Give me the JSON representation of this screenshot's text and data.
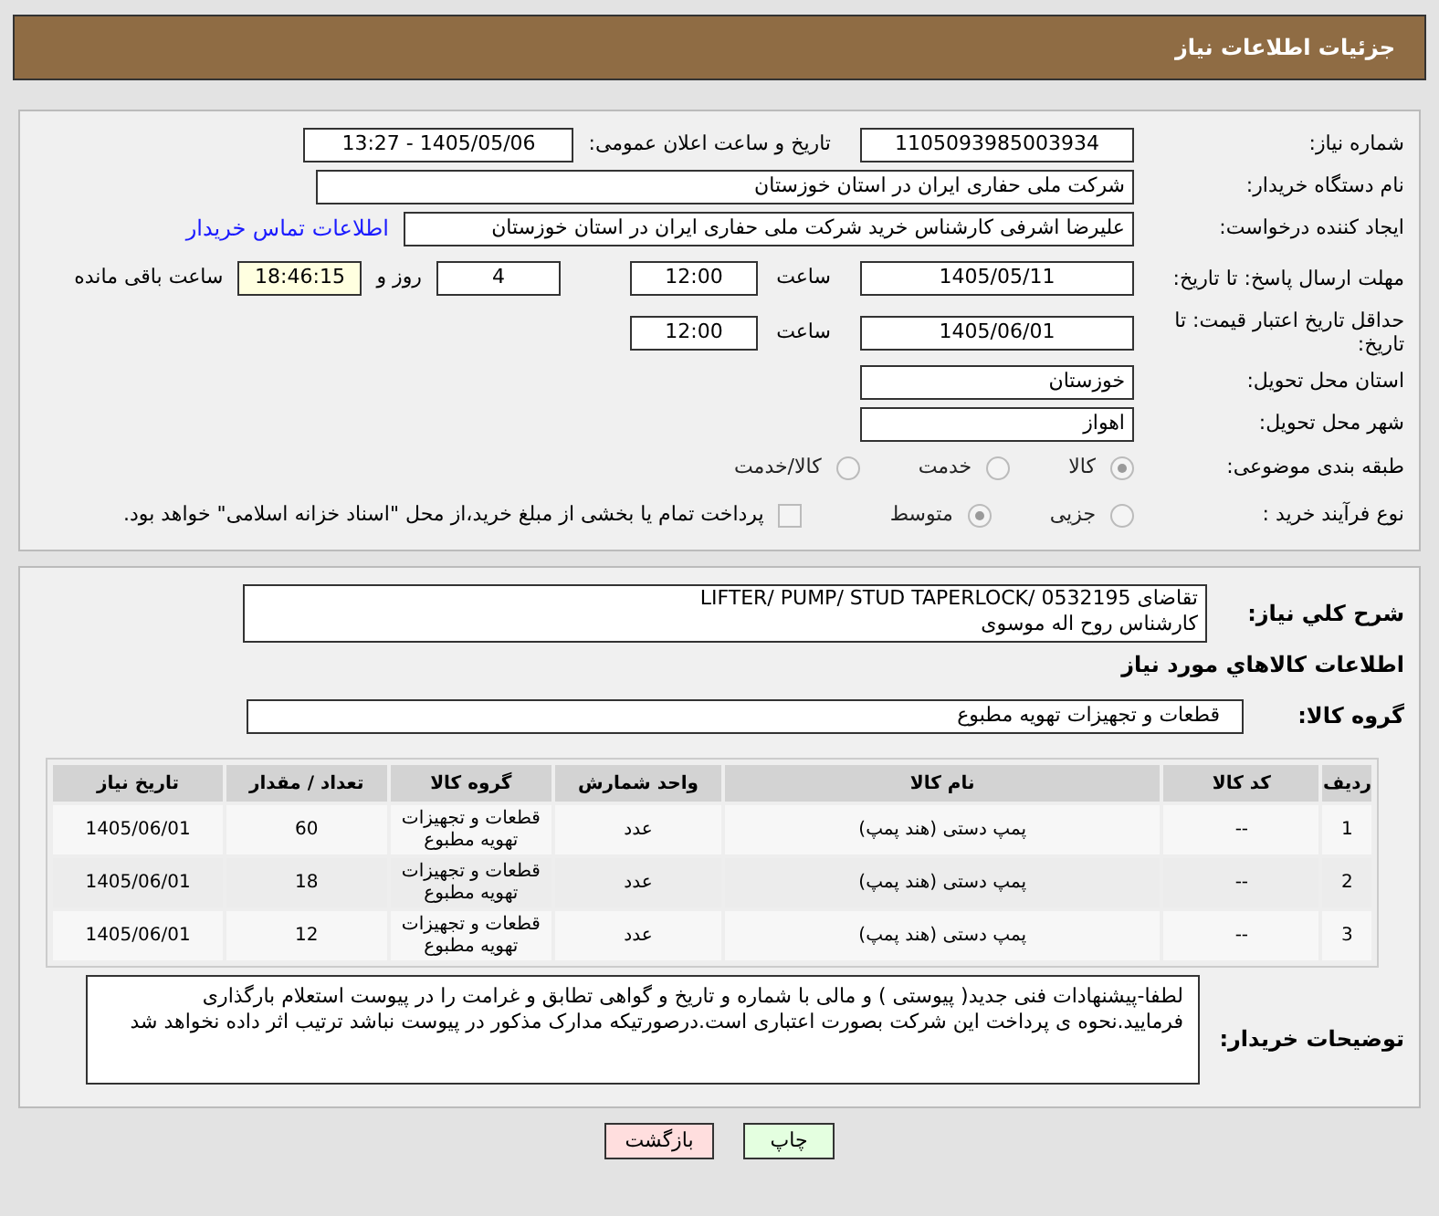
{
  "header": {
    "title": "جزئیات اطلاعات نیاز"
  },
  "details": {
    "need_number": {
      "label": "شماره نیاز:",
      "value": "1105093985003934"
    },
    "announce": {
      "label": "تاریخ و ساعت اعلان عمومی:",
      "value": "1405/05/06 - 13:27"
    },
    "buyer_org": {
      "label": "نام دستگاه خریدار:",
      "value": "شرکت ملی حفاری ایران در استان خوزستان"
    },
    "creator": {
      "label": "ایجاد کننده درخواست:",
      "value": "علیرضا اشرفی کارشناس خرید شرکت ملی حفاری ایران در استان خوزستان",
      "link": "اطلاعات تماس خریدار"
    },
    "deadline": {
      "label": "مهلت ارسال پاسخ: تا تاریخ:",
      "date": "1405/05/11",
      "time_label": "ساعت",
      "time": "12:00",
      "days": "4",
      "days_label": "روز و",
      "remaining": "18:46:15",
      "remaining_label": "ساعت باقی مانده"
    },
    "validity": {
      "label": "حداقل تاریخ اعتبار قیمت: تا تاریخ:",
      "date": "1405/06/01",
      "time_label": "ساعت",
      "time": "12:00"
    },
    "province": {
      "label": "استان محل تحویل:",
      "value": "خوزستان"
    },
    "city": {
      "label": "شهر محل تحویل:",
      "value": "اهواز"
    },
    "category": {
      "label": "طبقه بندی موضوعی:",
      "options": [
        {
          "label": "کالا",
          "selected": true
        },
        {
          "label": "خدمت",
          "selected": false
        },
        {
          "label": "کالا/خدمت",
          "selected": false
        }
      ]
    },
    "process": {
      "label": "نوع فرآیند خرید :",
      "options": [
        {
          "label": "جزیی",
          "selected": false
        },
        {
          "label": "متوسط",
          "selected": true
        }
      ],
      "payment": {
        "label": "پرداخت تمام یا بخشی از مبلغ خرید،از محل \"اسناد خزانه اسلامی\" خواهد بود.",
        "checked": false
      }
    }
  },
  "summary": {
    "label": "شرح کلي نیاز:",
    "lines": [
      "تقاضای LIFTER/ PUMP/ STUD TAPERLOCK/ 0532195",
      "کارشناس روح اله موسوی"
    ]
  },
  "goods_heading": "اطلاعات کالاهاي مورد نیاز",
  "goods_group": {
    "label": "گروه کالا:",
    "value": "قطعات و تجهیزات تهویه مطبوع"
  },
  "table": {
    "columns": [
      "ردیف",
      "کد کالا",
      "نام کالا",
      "واحد شمارش",
      "گروه کالا",
      "تعداد / مقدار",
      "تاریخ نیاز"
    ],
    "rows": [
      [
        "1",
        "--",
        "پمپ دستی (هند پمپ)",
        "عدد",
        "قطعات و تجهیزات تهویه مطبوع",
        "60",
        "1405/06/01"
      ],
      [
        "2",
        "--",
        "پمپ دستی (هند پمپ)",
        "عدد",
        "قطعات و تجهیزات تهویه مطبوع",
        "18",
        "1405/06/01"
      ],
      [
        "3",
        "--",
        "پمپ دستی (هند پمپ)",
        "عدد",
        "قطعات و تجهیزات تهویه مطبوع",
        "12",
        "1405/06/01"
      ]
    ]
  },
  "notes": {
    "label": "توضیحات خریدار:",
    "value": "لطفا-پیشنهادات فنی جدید( پیوستی ) و مالی با شماره و تاریخ و گواهی تطابق و غرامت را در پیوست استعلام بارگذاری فرمایید.نحوه ی پرداخت این شرکت بصورت اعتباری است.درصورتیکه مدارک مذکور در پیوست نباشد ترتیب اثر داده نخواهد شد"
  },
  "buttons": [
    {
      "label": "چاپ",
      "kind": "print"
    },
    {
      "label": "بازگشت",
      "kind": "back"
    }
  ]
}
